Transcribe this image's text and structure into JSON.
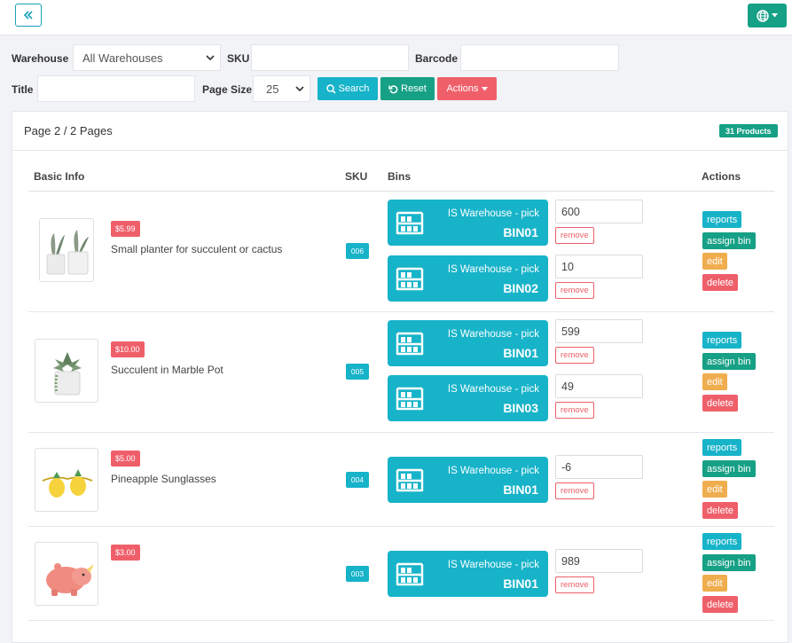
{
  "filters": {
    "warehouse_label": "Warehouse",
    "warehouse_value": "All Warehouses",
    "sku_label": "SKU",
    "sku_value": "",
    "barcode_label": "Barcode",
    "barcode_value": "",
    "title_label": "Title",
    "title_value": "",
    "page_size_label": "Page Size",
    "page_size_value": "25",
    "search_label": "Search",
    "reset_label": "Reset",
    "actions_label": "Actions"
  },
  "list": {
    "page_info": "Page 2 / 2 Pages",
    "count_badge": "31 Products",
    "columns": [
      "Basic Info",
      "SKU",
      "Bins",
      "Actions"
    ]
  },
  "action_labels": {
    "reports": "reports",
    "assign": "assign bin",
    "edit": "edit",
    "delete": "delete",
    "remove": "remove"
  },
  "products": [
    {
      "price": "$5.99",
      "name": "Small planter for succulent or cactus",
      "sku": "006",
      "bins": [
        {
          "warehouse": "IS Warehouse - pick",
          "code": "BIN01",
          "qty": "600"
        },
        {
          "warehouse": "IS Warehouse - pick",
          "code": "BIN02",
          "qty": "10"
        }
      ]
    },
    {
      "price": "$10.00",
      "name": "Succulent in Marble Pot",
      "sku": "005",
      "bins": [
        {
          "warehouse": "IS Warehouse - pick",
          "code": "BIN01",
          "qty": "599"
        },
        {
          "warehouse": "IS Warehouse - pick",
          "code": "BIN03",
          "qty": "49"
        }
      ]
    },
    {
      "price": "$5.00",
      "name": "Pineapple Sunglasses",
      "sku": "004",
      "bins": [
        {
          "warehouse": "IS Warehouse - pick",
          "code": "BIN01",
          "qty": "-6"
        }
      ]
    },
    {
      "price": "$3.00",
      "name": "",
      "sku": "003",
      "bins": [
        {
          "warehouse": "IS Warehouse - pick",
          "code": "BIN01",
          "qty": "989"
        }
      ]
    }
  ],
  "icons": {
    "collapse": "double-chevron-left-icon",
    "language": "globe-icon",
    "bin": "shelf-icon"
  },
  "colors": {
    "info": "#17b3c9",
    "success": "#16a085",
    "danger": "#ef5f6a",
    "warning": "#f0ad4e"
  }
}
